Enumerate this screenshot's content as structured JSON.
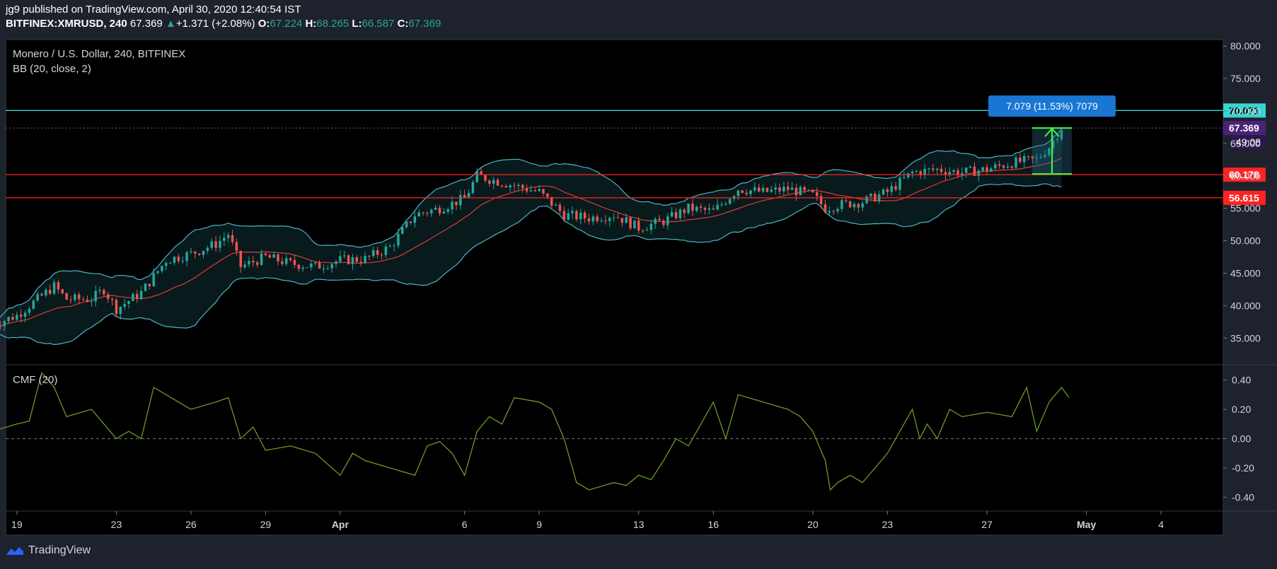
{
  "header": {
    "publisher": "jg9 published on TradingView.com, April 30, 2020 12:40:54 IST",
    "symbol": "BITFINEX:XMRUSD, 240",
    "last": "67.369",
    "change": "+1.371 (+2.08%)",
    "o_label": "O:",
    "o_value": "67.224",
    "h_label": "H:",
    "h_value": "68.265",
    "l_label": "L:",
    "l_value": "66.587",
    "c_label": "C:",
    "c_value": "67.369"
  },
  "legend": {
    "title": "Monero / U.S. Dollar, 240, BITFINEX",
    "indicator": "BB (20, close, 2)",
    "cmf_label": "CMF (20)"
  },
  "footer": {
    "brand": "TradingView"
  },
  "colors": {
    "background": "#000000",
    "up": "#26a69a",
    "down": "#ef5350",
    "bb_band": "#4fb3c6",
    "bb_basis": "#e0393e",
    "hline_red": "#ff2222",
    "hline_cyan": "#35d6d2",
    "cmf": "#6b9a2a",
    "measure": "#3cff3c"
  },
  "chart_data": [
    {
      "type": "candlestick",
      "title": "Monero / U.S. Dollar, 240, BITFINEX",
      "x_tick_labels": [
        "19",
        "23",
        "26",
        "29",
        "Apr",
        "6",
        "9",
        "13",
        "16",
        "20",
        "23",
        "27",
        "May",
        "4"
      ],
      "x_tick_dates": [
        "2020-03-19",
        "2020-03-23",
        "2020-03-26",
        "2020-03-29",
        "2020-04-01",
        "2020-04-06",
        "2020-04-09",
        "2020-04-13",
        "2020-04-16",
        "2020-04-20",
        "2020-04-23",
        "2020-04-27",
        "2020-05-01",
        "2020-05-04"
      ],
      "x_range": [
        "2020-03-18",
        "2020-05-06"
      ],
      "ylim": [
        31,
        81
      ],
      "y_ticks": [
        35,
        40,
        45,
        50,
        55,
        60,
        65,
        70,
        75,
        80
      ],
      "y_tick_labels": [
        "35.000",
        "40.000",
        "45.000",
        "50.000",
        "55.000",
        "60.000",
        "65.000",
        "70.000",
        "75.000",
        "80.000"
      ],
      "price_path": [
        [
          "2020-03-18",
          37.0
        ],
        [
          "2020-03-19",
          38.5
        ],
        [
          "2020-03-20",
          41.5
        ],
        [
          "2020-03-20.5",
          43.0
        ],
        [
          "2020-03-21",
          41.0
        ],
        [
          "2020-03-22",
          41.0
        ],
        [
          "2020-03-22.5",
          42.5
        ],
        [
          "2020-03-23",
          39.5
        ],
        [
          "2020-03-24",
          42.0
        ],
        [
          "2020-03-25",
          47.0
        ],
        [
          "2020-03-26",
          48.0
        ],
        [
          "2020-03-27",
          49.5
        ],
        [
          "2020-03-27.5",
          51.0
        ],
        [
          "2020-03-28",
          46.0
        ],
        [
          "2020-03-29",
          47.5
        ],
        [
          "2020-03-30",
          46.5
        ],
        [
          "2020-03-31",
          46.0
        ],
        [
          "2020-04-01",
          47.0
        ],
        [
          "2020-04-02",
          47.2
        ],
        [
          "2020-04-03",
          49.0
        ],
        [
          "2020-04-04",
          54.0
        ],
        [
          "2020-04-05",
          55.0
        ],
        [
          "2020-04-06",
          56.5
        ],
        [
          "2020-04-06.5",
          60.0
        ],
        [
          "2020-04-07",
          59.5
        ],
        [
          "2020-04-08",
          58.5
        ],
        [
          "2020-04-09",
          57.5
        ],
        [
          "2020-04-10",
          54.0
        ],
        [
          "2020-04-11",
          53.5
        ],
        [
          "2020-04-12",
          54.0
        ],
        [
          "2020-04-13",
          52.0
        ],
        [
          "2020-04-14",
          53.0
        ],
        [
          "2020-04-15",
          55.0
        ],
        [
          "2020-04-16",
          54.5
        ],
        [
          "2020-04-17",
          58.0
        ],
        [
          "2020-04-18",
          57.5
        ],
        [
          "2020-04-19",
          58.0
        ],
        [
          "2020-04-20",
          57.0
        ],
        [
          "2020-04-20.5",
          55.0
        ],
        [
          "2020-04-21",
          55.5
        ],
        [
          "2020-04-22",
          56.0
        ],
        [
          "2020-04-23",
          57.5
        ],
        [
          "2020-04-24",
          60.5
        ],
        [
          "2020-04-25",
          61.0
        ],
        [
          "2020-04-26",
          60.5
        ],
        [
          "2020-04-27",
          61.0
        ],
        [
          "2020-04-28",
          62.0
        ],
        [
          "2020-04-29",
          62.5
        ],
        [
          "2020-04-29.5",
          64.5
        ],
        [
          "2020-04-30",
          67.4
        ]
      ],
      "horizontal_lines": [
        {
          "value": 70.071,
          "label": "70.071",
          "color": "#35d6d2"
        },
        {
          "value": 60.178,
          "label": "60.178",
          "color": "#ff2222"
        },
        {
          "value": 56.615,
          "label": "56.615",
          "color": "#ff2222"
        }
      ],
      "last_price": {
        "value": 67.369,
        "label": "67.369",
        "countdown": "49:08"
      },
      "measure_tool": {
        "from": 60.29,
        "to": 67.369,
        "label": "7.079 (11.53%) 7079"
      }
    },
    {
      "type": "line",
      "title": "CMF (20)",
      "ylim": [
        -0.48,
        0.5
      ],
      "y_ticks": [
        -0.4,
        -0.2,
        0.0,
        0.2,
        0.4
      ],
      "y_tick_labels": [
        "-0.40",
        "-0.20",
        "0.00",
        "0.20",
        "0.40"
      ],
      "series": [
        {
          "points": [
            [
              "2020-03-18",
              0.05
            ],
            [
              "2020-03-19",
              0.1
            ],
            [
              "2020-03-19.5",
              0.12
            ],
            [
              "2020-03-20",
              0.45
            ],
            [
              "2020-03-20.5",
              0.35
            ],
            [
              "2020-03-21",
              0.15
            ],
            [
              "2020-03-22",
              0.2
            ],
            [
              "2020-03-23",
              0.0
            ],
            [
              "2020-03-23.5",
              0.05
            ],
            [
              "2020-03-24",
              0.0
            ],
            [
              "2020-03-24.5",
              0.35
            ],
            [
              "2020-03-25",
              0.3
            ],
            [
              "2020-03-26",
              0.2
            ],
            [
              "2020-03-27",
              0.25
            ],
            [
              "2020-03-27.5",
              0.28
            ],
            [
              "2020-03-28",
              0.0
            ],
            [
              "2020-03-28.5",
              0.08
            ],
            [
              "2020-03-29",
              -0.08
            ],
            [
              "2020-03-30",
              -0.05
            ],
            [
              "2020-03-31",
              -0.1
            ],
            [
              "2020-04-01",
              -0.25
            ],
            [
              "2020-04-01.5",
              -0.1
            ],
            [
              "2020-04-02",
              -0.15
            ],
            [
              "2020-04-03",
              -0.2
            ],
            [
              "2020-04-04",
              -0.25
            ],
            [
              "2020-04-04.5",
              -0.05
            ],
            [
              "2020-04-05",
              -0.02
            ],
            [
              "2020-04-05.5",
              -0.1
            ],
            [
              "2020-04-06",
              -0.25
            ],
            [
              "2020-04-06.5",
              0.05
            ],
            [
              "2020-04-07",
              0.15
            ],
            [
              "2020-04-07.5",
              0.1
            ],
            [
              "2020-04-08",
              0.28
            ],
            [
              "2020-04-09",
              0.25
            ],
            [
              "2020-04-09.5",
              0.2
            ],
            [
              "2020-04-10",
              0.0
            ],
            [
              "2020-04-10.5",
              -0.3
            ],
            [
              "2020-04-11",
              -0.35
            ],
            [
              "2020-04-12",
              -0.3
            ],
            [
              "2020-04-12.5",
              -0.32
            ],
            [
              "2020-04-13",
              -0.25
            ],
            [
              "2020-04-13.5",
              -0.28
            ],
            [
              "2020-04-14",
              -0.15
            ],
            [
              "2020-04-14.5",
              0.0
            ],
            [
              "2020-04-15",
              -0.05
            ],
            [
              "2020-04-15.5",
              0.1
            ],
            [
              "2020-04-16",
              0.25
            ],
            [
              "2020-04-16.5",
              0.0
            ],
            [
              "2020-04-17",
              0.3
            ],
            [
              "2020-04-18",
              0.25
            ],
            [
              "2020-04-19",
              0.2
            ],
            [
              "2020-04-19.5",
              0.15
            ],
            [
              "2020-04-20",
              0.05
            ],
            [
              "2020-04-20.5",
              -0.15
            ],
            [
              "2020-04-20.7",
              -0.35
            ],
            [
              "2020-04-21",
              -0.3
            ],
            [
              "2020-04-21.5",
              -0.25
            ],
            [
              "2020-04-22",
              -0.3
            ],
            [
              "2020-04-22.5",
              -0.2
            ],
            [
              "2020-04-23",
              -0.1
            ],
            [
              "2020-04-23.5",
              0.05
            ],
            [
              "2020-04-24",
              0.2
            ],
            [
              "2020-04-24.3",
              0.0
            ],
            [
              "2020-04-24.6",
              0.1
            ],
            [
              "2020-04-25",
              0.0
            ],
            [
              "2020-04-25.5",
              0.2
            ],
            [
              "2020-04-26",
              0.15
            ],
            [
              "2020-04-27",
              0.18
            ],
            [
              "2020-04-28",
              0.15
            ],
            [
              "2020-04-28.3",
              0.25
            ],
            [
              "2020-04-28.6",
              0.35
            ],
            [
              "2020-04-29",
              0.05
            ],
            [
              "2020-04-29.5",
              0.25
            ],
            [
              "2020-04-30",
              0.35
            ],
            [
              "2020-04-30.3",
              0.28
            ]
          ]
        }
      ]
    }
  ]
}
